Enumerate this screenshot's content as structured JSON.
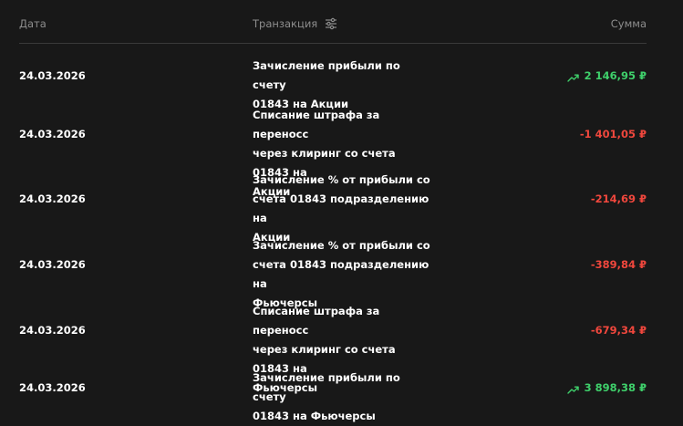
{
  "header": {
    "date": "Дата",
    "transaction": "Транзакция",
    "amount": "Сумма"
  },
  "rows": [
    {
      "date": "24.03.2026",
      "tx_lines": [
        "Зачисление прибыли по счету",
        "01843 на Акции"
      ],
      "amount": "2 146,95 ₽",
      "sign": "positive"
    },
    {
      "date": "24.03.2026",
      "tx_lines": [
        "Списание штрафа за переносс",
        "через клиринг со счета 01843 на",
        "Акции"
      ],
      "amount": "-1 401,05 ₽",
      "sign": "negative"
    },
    {
      "date": "24.03.2026",
      "tx_lines": [
        "Зачисление % от прибыли со",
        "счета 01843 подразделению на",
        "Акции"
      ],
      "amount": "-214,69 ₽",
      "sign": "negative"
    },
    {
      "date": "24.03.2026",
      "tx_lines": [
        "Зачисление % от прибыли со",
        "счета 01843 подразделению на",
        "Фьючерсы"
      ],
      "amount": "-389,84 ₽",
      "sign": "negative"
    },
    {
      "date": "24.03.2026",
      "tx_lines": [
        "Списание штрафа за переносс",
        "через клиринг со счета 01843 на",
        "Фьючерсы"
      ],
      "amount": "-679,34 ₽",
      "sign": "negative"
    },
    {
      "date": "24.03.2026",
      "tx_lines": [
        "Зачисление прибыли по счету",
        "01843 на Фьючерсы"
      ],
      "amount": "3 898,38 ₽",
      "sign": "positive"
    }
  ],
  "colors": {
    "background": "#181818",
    "positive": "#3fd06b",
    "negative": "#f0473d",
    "header_text": "#8d8d8d"
  },
  "icons": {
    "filter": "sliders-icon",
    "trend": "trend-up-icon"
  }
}
